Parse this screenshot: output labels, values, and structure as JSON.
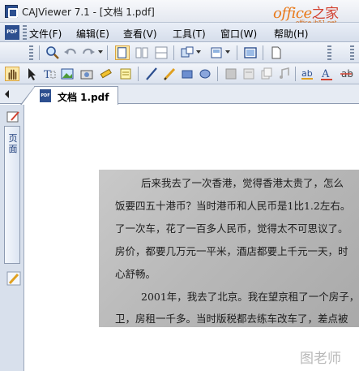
{
  "window": {
    "title": "CAJViewer 7.1 - [文档 1.pdf]"
  },
  "watermark_top": {
    "brand": "office",
    "brand_suffix": "之家",
    "url": "office.jb51.net"
  },
  "menu": {
    "items": [
      {
        "label": "文件(F)"
      },
      {
        "label": "编辑(E)"
      },
      {
        "label": "查看(V)"
      },
      {
        "label": "工具(T)"
      },
      {
        "label": "窗口(W)"
      },
      {
        "label": "帮助(H)"
      }
    ]
  },
  "toolbar1": {
    "icons": [
      "search-icon",
      "undo-icon",
      "redo-icon",
      "single-page-icon",
      "two-page-icon",
      "split-view-icon",
      "layout-icon",
      "view-mode-icon",
      "fit-screen-icon",
      "new-page-icon"
    ]
  },
  "toolbar2": {
    "icons": [
      "hand-tool-icon",
      "select-arrow-icon",
      "text-select-icon",
      "image-select-icon",
      "snapshot-icon",
      "highlight-marker-icon",
      "note-icon",
      "pen-icon",
      "pencil-icon",
      "rectangle-icon",
      "ellipse-icon",
      "eraser-icon",
      "ocr-icon",
      "copy-icon",
      "audio-icon",
      "underline-icon",
      "font-color-icon",
      "strike-icon"
    ]
  },
  "tabs": [
    {
      "label": "文档 1.pdf",
      "icon": "pdf-file-icon"
    }
  ],
  "sidepanel": {
    "tab_label": "页面",
    "icons": [
      "bookmark-edit-icon",
      "pen-annotate-icon"
    ]
  },
  "document": {
    "lines": [
      "后来我去了一次香港，觉得香港太贵了，怎么",
      "饭要四五十港币？当时港币和人民币是1比1.2左右。",
      "了一次车，花了一百多人民币，觉得太不可思议了。",
      "房价，都要几万元一平米，酒店都要上千元一天，时",
      "心舒畅。",
      "2001年，我去了北京。我在望京租了一个房子，",
      "卫，房租一千多。当时版税都去练车改车了，差点被"
    ]
  },
  "watermark_bottom": {
    "text": "图老师"
  },
  "colors": {
    "accent": "#2d4f8f",
    "toolbar_bg": "#dbe2ee",
    "office_orange": "#e8791a"
  }
}
